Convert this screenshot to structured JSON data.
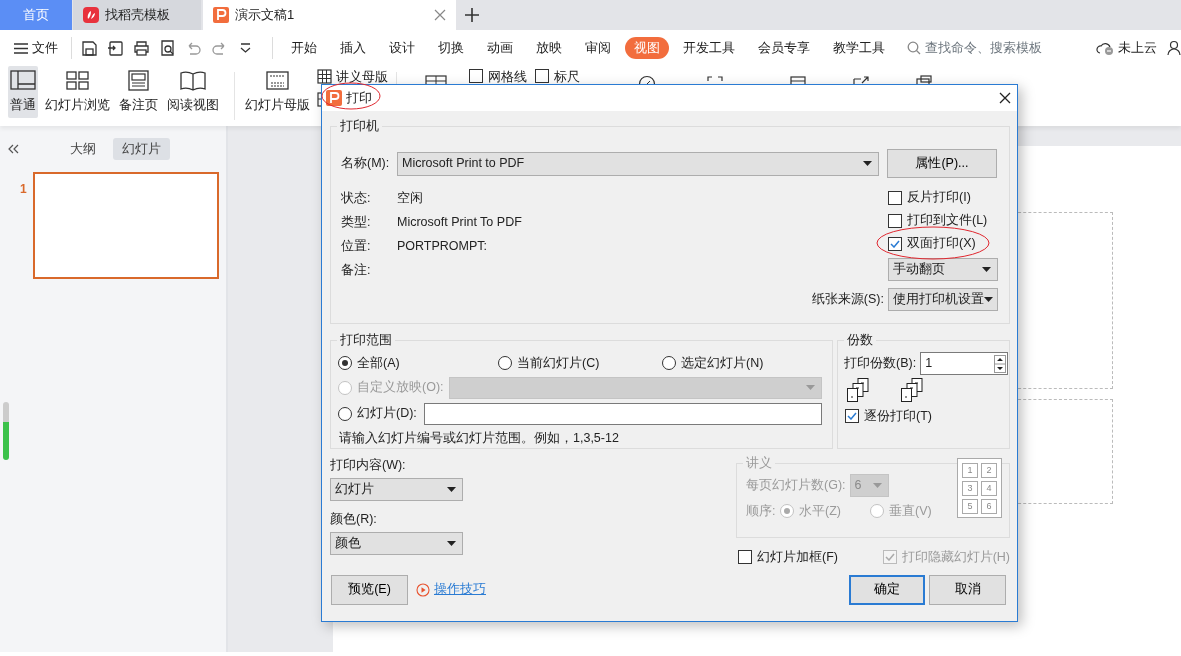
{
  "tabs": [
    {
      "label": "首页",
      "kind": "home",
      "selected": false
    },
    {
      "label": "找稻壳模板",
      "kind": "docer",
      "selected": false
    },
    {
      "label": "演示文稿1",
      "kind": "doc",
      "selected": true
    }
  ],
  "menu": {
    "file_label": "文件",
    "items": [
      {
        "label": "开始",
        "selected": false
      },
      {
        "label": "插入",
        "selected": false
      },
      {
        "label": "设计",
        "selected": false
      },
      {
        "label": "切换",
        "selected": false
      },
      {
        "label": "动画",
        "selected": false
      },
      {
        "label": "放映",
        "selected": false
      },
      {
        "label": "审阅",
        "selected": false
      },
      {
        "label": "视图",
        "selected": true
      },
      {
        "label": "开发工具",
        "selected": false
      },
      {
        "label": "会员专享",
        "selected": false
      },
      {
        "label": "教学工具",
        "selected": false
      }
    ],
    "search": {
      "placeholder": "查找命令、搜索模板"
    },
    "cloud": "未上云"
  },
  "ribbon": {
    "buttons": [
      {
        "label": "普通",
        "selected": true
      },
      {
        "label": "幻灯片浏览",
        "selected": false
      },
      {
        "label": "备注页",
        "selected": false
      },
      {
        "label": "阅读视图",
        "selected": false
      },
      {
        "label": "幻灯片母版",
        "selected": false
      }
    ],
    "small_button": "讲义母版",
    "checkboxes": [
      {
        "label": "网格线",
        "checked": false
      },
      {
        "label": "标尺",
        "checked": false
      }
    ]
  },
  "sidebar": {
    "tabs": [
      {
        "label": "大纲",
        "selected": false
      },
      {
        "label": "幻灯片",
        "selected": true
      }
    ],
    "slides": [
      {
        "number": "1",
        "selected": true
      }
    ]
  },
  "dialog": {
    "title": "打印",
    "title_circled": true,
    "printer": {
      "title": "打印机",
      "name_label": "名称(M):",
      "name": "Microsoft Print to PDF",
      "properties_button": "属性(P)...",
      "info": [
        {
          "label": "状态:",
          "value": "空闲"
        },
        {
          "label": "类型:",
          "value": "Microsoft Print To PDF"
        },
        {
          "label": "位置:",
          "value": "PORTPROMPT:"
        },
        {
          "label": "备注:"
        }
      ],
      "options": [
        {
          "label": "反片打印(I)",
          "checked": false,
          "circled": false
        },
        {
          "label": "打印到文件(L)",
          "checked": false,
          "circled": false
        },
        {
          "label": "双面打印(X)",
          "checked": true,
          "circled": true
        }
      ],
      "duplex_mode": "手动翻页",
      "paper_source_label": "纸张来源(S):",
      "paper_source": "使用打印机设置"
    },
    "range": {
      "title": "打印范围",
      "options": [
        {
          "label": "全部(A)",
          "selected": true,
          "disabled": false
        },
        {
          "label": "当前幻灯片(C)",
          "selected": false,
          "disabled": false
        },
        {
          "label": "选定幻灯片(N)",
          "selected": false,
          "disabled": false
        },
        {
          "label": "自定义放映(O):",
          "selected": false,
          "disabled": true
        },
        {
          "label": "幻灯片(D):",
          "selected": false,
          "disabled": false
        }
      ],
      "hint": "请输入幻灯片编号或幻灯片范围。例如，1,3,5-12"
    },
    "copies": {
      "title": "份数",
      "label": "打印份数(B):",
      "value": "1",
      "collate": {
        "label": "逐份打印(T)",
        "checked": true
      }
    },
    "content_label": "打印内容(W):",
    "content": "幻灯片",
    "color_mode_label": "颜色(R):",
    "color_mode": "颜色",
    "handout": {
      "title": "讲义",
      "disabled": true,
      "per_page_label": "每页幻灯片数(G):",
      "per_page": "6",
      "order_label": "顺序:",
      "orders": [
        {
          "label": "水平(Z)",
          "selected": true
        },
        {
          "label": "垂直(V)",
          "selected": false
        }
      ],
      "grid": [
        "1",
        "2",
        "3",
        "4",
        "5",
        "6"
      ]
    },
    "frame": {
      "label": "幻灯片加框(F)",
      "checked": false,
      "disabled": false
    },
    "hidden": {
      "label": "打印隐藏幻灯片(H)",
      "checked": true,
      "disabled": true
    },
    "preview_button": "预览(E)",
    "tips_link": "操作技巧",
    "ok_button": "确定",
    "cancel_button": "取消"
  }
}
